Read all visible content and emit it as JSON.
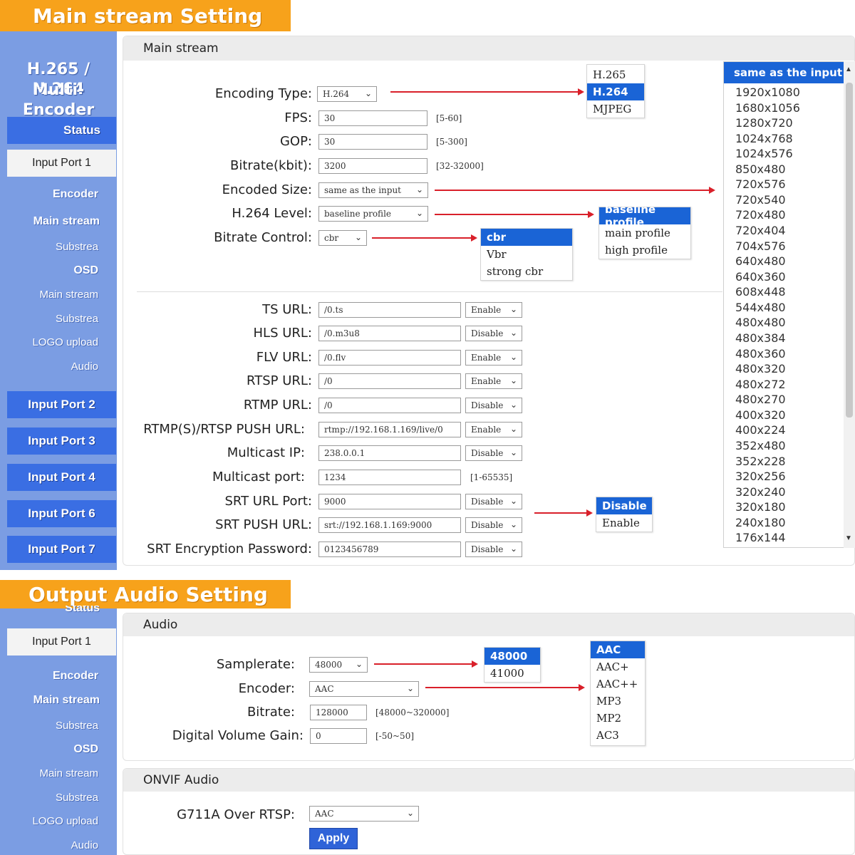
{
  "banners": {
    "main": "Main stream Setting",
    "audio": "Output Audio Setting"
  },
  "brand": {
    "line1": "H.265 / H.264",
    "line2": "Multi-Encoder"
  },
  "nav_top": {
    "status": "Status",
    "input_port_1": "Input Port 1",
    "encoder": "Encoder",
    "main_stream": "Main stream",
    "substream": "Substrea",
    "osd": "OSD",
    "osd_main": "Main stream",
    "osd_sub": "Substrea",
    "logo_upload": "LOGO upload",
    "audio": "Audio",
    "ports": [
      "Input Port 2",
      "Input Port 3",
      "Input Port 4",
      "Input Port 6",
      "Input Port 7"
    ]
  },
  "nav_bottom": {
    "status": "Status",
    "input_port_1": "Input Port 1",
    "encoder": "Encoder",
    "main_stream": "Main stream",
    "substream": "Substrea",
    "osd": "OSD",
    "osd_main": "Main stream",
    "osd_sub": "Substrea",
    "logo_upload": "LOGO upload",
    "audio": "Audio"
  },
  "main_panel": {
    "title": "Main stream",
    "encoding_type": {
      "label": "Encoding Type:",
      "value": "H.264"
    },
    "fps": {
      "label": "FPS:",
      "value": "30",
      "range": "[5-60]"
    },
    "gop": {
      "label": "GOP:",
      "value": "30",
      "range": "[5-300]"
    },
    "bitrate": {
      "label": "Bitrate(kbit):",
      "value": "3200",
      "range": "[32-32000]"
    },
    "encoded_size": {
      "label": "Encoded Size:",
      "value": "same as the input"
    },
    "h264_level": {
      "label": "H.264 Level:",
      "value": "baseline profile"
    },
    "bitrate_control": {
      "label": "Bitrate Control:",
      "value": "cbr"
    },
    "urls": [
      {
        "label": "TS URL:",
        "value": "/0.ts",
        "state": "Enable"
      },
      {
        "label": "HLS URL:",
        "value": "/0.m3u8",
        "state": "Disable"
      },
      {
        "label": "FLV URL:",
        "value": "/0.flv",
        "state": "Enable"
      },
      {
        "label": "RTSP URL:",
        "value": "/0",
        "state": "Enable"
      },
      {
        "label": "RTMP URL:",
        "value": "/0",
        "state": "Disable"
      },
      {
        "label": "RTMP(S)/RTSP PUSH URL:",
        "value": "rtmp://192.168.1.169/live/0",
        "state": "Enable"
      },
      {
        "label": "Multicast IP:",
        "value": "238.0.0.1",
        "state": "Disable"
      }
    ],
    "multicast_port": {
      "label": "Multicast port:",
      "value": "1234",
      "range": "[1-65535]"
    },
    "srt_rows": [
      {
        "label": "SRT URL Port:",
        "value": "9000",
        "state": "Disable"
      },
      {
        "label": "SRT PUSH URL:",
        "value": "srt://192.168.1.169:9000",
        "state": "Disable"
      },
      {
        "label": "SRT Encryption Password:",
        "value": "0123456789",
        "state": "Disable"
      }
    ]
  },
  "encoding_options": [
    "H.265",
    "H.264",
    "MJPEG"
  ],
  "profile_options": [
    "baseline profile",
    "main profile",
    "high profile"
  ],
  "bitrate_control_options": [
    "cbr",
    "Vbr",
    "strong cbr"
  ],
  "srt_options": [
    "Disable",
    "Enable"
  ],
  "resolutions": {
    "selected": "same as the input",
    "items": [
      "1920x1080",
      "1680x1056",
      "1280x720",
      "1024x768",
      "1024x576",
      "850x480",
      "720x576",
      "720x540",
      "720x480",
      "720x404",
      "704x576",
      "640x480",
      "640x360",
      "608x448",
      "544x480",
      "480x480",
      "480x384",
      "480x360",
      "480x320",
      "480x272",
      "480x270",
      "400x320",
      "400x224",
      "352x480",
      "352x228",
      "320x256",
      "320x240",
      "320x180",
      "240x180",
      "176x144"
    ]
  },
  "audio_panel": {
    "title": "Audio",
    "samplerate": {
      "label": "Samplerate:",
      "value": "48000"
    },
    "encoder": {
      "label": "Encoder:",
      "value": "AAC"
    },
    "bitrate": {
      "label": "Bitrate:",
      "value": "128000",
      "range": "[48000~320000]"
    },
    "volume": {
      "label": "Digital Volume Gain:",
      "value": "0",
      "range": "[-50~50]"
    }
  },
  "samplerate_options": [
    "48000",
    "41000"
  ],
  "audio_encoder_options": [
    "AAC",
    "AAC+",
    "AAC++",
    "MP3",
    "MP2",
    "AC3"
  ],
  "onvif_panel": {
    "title": "ONVIF Audio",
    "g711a": {
      "label": "G711A Over RTSP:",
      "value": "AAC"
    },
    "apply": "Apply"
  },
  "colors": {
    "banner": "#f7a21b",
    "sidebar": "#7b9de3",
    "nav_button": "#3a6ee3",
    "highlight": "#1a64d6",
    "arrow": "#d9202a"
  }
}
